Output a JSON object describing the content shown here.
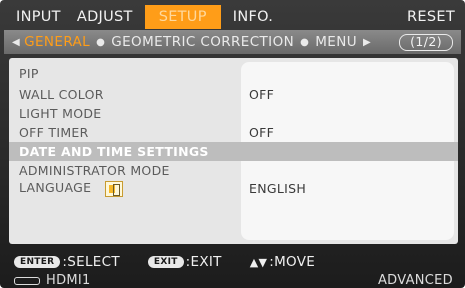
{
  "tabs": [
    {
      "label": "INPUT"
    },
    {
      "label": "ADJUST"
    },
    {
      "label": "SETUP"
    },
    {
      "label": "INFO."
    },
    {
      "label": "RESET"
    }
  ],
  "subbar": {
    "active": "GENERAL",
    "items": [
      "GEOMETRIC CORRECTION",
      "MENU"
    ],
    "page": "(1/2)"
  },
  "rows": [
    {
      "label": "PIP",
      "value": ""
    },
    {
      "label": "WALL COLOR",
      "value": "OFF"
    },
    {
      "label": "LIGHT MODE",
      "value": ""
    },
    {
      "label": "OFF TIMER",
      "value": "OFF"
    },
    {
      "label": "DATE AND TIME SETTINGS",
      "value": ""
    },
    {
      "label": "ADMINISTRATOR MODE",
      "value": ""
    },
    {
      "label": "LANGUAGE",
      "value": "ENGLISH"
    }
  ],
  "help": {
    "enter_key": "ENTER",
    "enter_text": ":SELECT",
    "exit_key": "EXIT",
    "exit_text": ":EXIT",
    "move_text": ":MOVE"
  },
  "status": {
    "input": "HDMI1",
    "mode": "ADVANCED"
  },
  "colors": {
    "accent": "#ff9d18",
    "panel": "#e6e6e6",
    "selected_row": "#bdbdbd"
  }
}
